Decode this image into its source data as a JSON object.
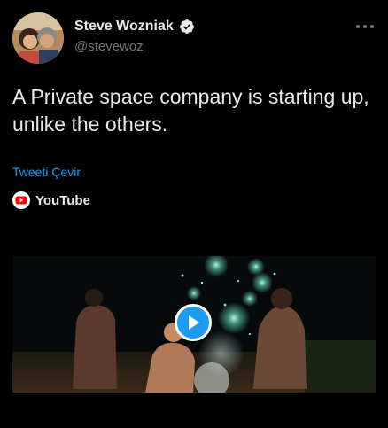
{
  "author": {
    "display_name": "Steve Wozniak",
    "handle": "@stevewoz",
    "verified": true,
    "avatar_icon": "profile-photo"
  },
  "tweet": {
    "text": "A Private space company is starting up, unlike the others.",
    "translate_label": "Tweeti Çevir"
  },
  "source": {
    "icon": "youtube-icon",
    "name": "YouTube"
  },
  "media": {
    "type": "video",
    "play_icon": "play-icon"
  },
  "colors": {
    "background": "#000000",
    "text": "#e7e9ea",
    "secondary": "#71767b",
    "accent": "#1d9bf0",
    "youtube_red": "#ff0000"
  }
}
